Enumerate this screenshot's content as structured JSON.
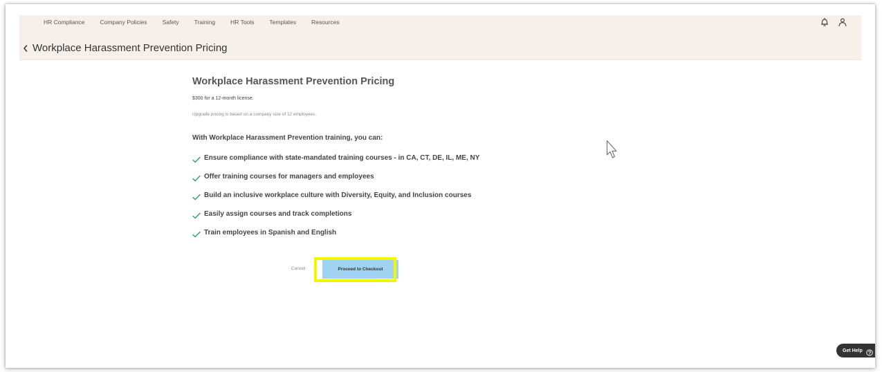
{
  "nav": {
    "items": [
      {
        "label": "HR Compliance"
      },
      {
        "label": "Company Policies"
      },
      {
        "label": "Safety"
      },
      {
        "label": "Training"
      },
      {
        "label": "HR Tools"
      },
      {
        "label": "Templates"
      },
      {
        "label": "Resources"
      }
    ],
    "icons": [
      "bell-icon",
      "user-icon"
    ]
  },
  "header": {
    "title": "Workplace Harassment Prevention Pricing",
    "back_icon": "chevron-left-icon"
  },
  "main": {
    "heading": "Workplace Harassment Prevention Pricing",
    "price_text": "$300 for a 12-month license.",
    "upgrade_note": "Upgrade pricing is based on a company size of 12 employees.",
    "intro": "With Workplace Harassment Prevention training, you can:",
    "benefits": [
      {
        "text": "Ensure compliance with state-mandated training courses - in CA, CT, DE, IL, ME, NY"
      },
      {
        "text": "Offer training courses for managers and employees"
      },
      {
        "text": "Build an inclusive workplace culture with Diversity, Equity, and Inclusion courses"
      },
      {
        "text": "Easily assign courses and track completions"
      },
      {
        "text": "Train employees in Spanish and English"
      }
    ],
    "check_icon": "check-icon"
  },
  "actions": {
    "cancel_label": "Cancel",
    "checkout_label": "Proceed to Checkout"
  },
  "help": {
    "label": "Get Help",
    "icon": "help-circle-icon"
  },
  "colors": {
    "nav_bg": "#f7f0ea",
    "check": "#2e9e6a",
    "checkout_bg": "#9fd3f1",
    "highlight": "#f6f500",
    "help_bg": "#333333"
  }
}
